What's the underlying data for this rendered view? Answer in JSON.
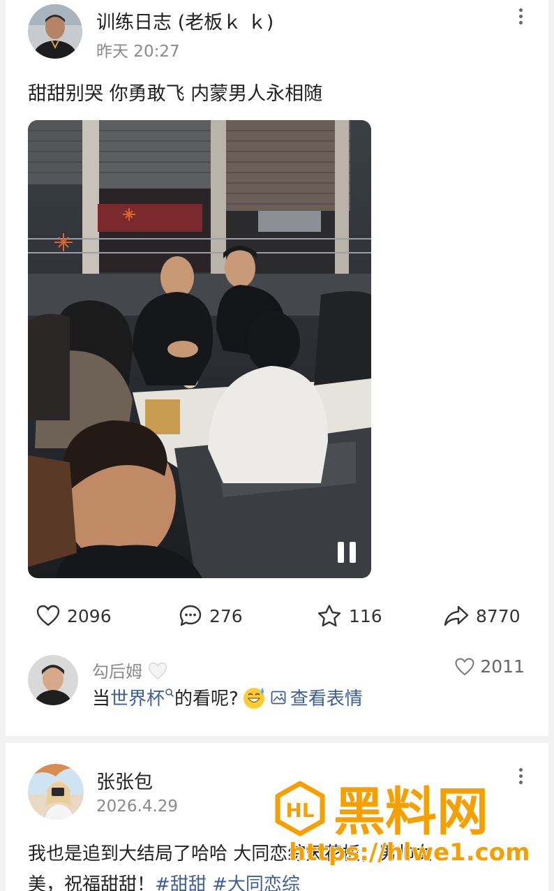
{
  "post": {
    "author": "训练日志 (老板ｋ ｋ)",
    "time": "昨天 20:27",
    "text": "甜甜别哭 你勇敢飞 内蒙男人永相随",
    "likes": "2096",
    "comments": "276",
    "favorites": "116",
    "shares": "8770"
  },
  "top_comment": {
    "name": "勾后姆",
    "text_before": "当",
    "link": "世界杯",
    "text_after": "的看呢?",
    "sticker_label": "查看表情",
    "likes": "2011"
  },
  "post2": {
    "author": "张张包",
    "time": "2026.4.29",
    "line1": "我也是追到大结局了哈哈 大同恋综天花板，男帅女",
    "line2_text": "美，祝福甜甜！",
    "tags": [
      "#甜甜",
      "#大同恋综"
    ]
  },
  "watermark": {
    "text": "黑料网",
    "url": "https://hlwe1.com"
  },
  "icons": {
    "like": "heart-icon",
    "comment": "comment-bubble-icon",
    "favorite": "star-icon",
    "share": "share-arrow-icon",
    "more": "more-vertical-icon",
    "pause": "pause-icon",
    "search": "search-small-icon",
    "sticker": "image-icon"
  },
  "colors": {
    "link": "#3d5d97",
    "watermark": "#f5a000"
  }
}
